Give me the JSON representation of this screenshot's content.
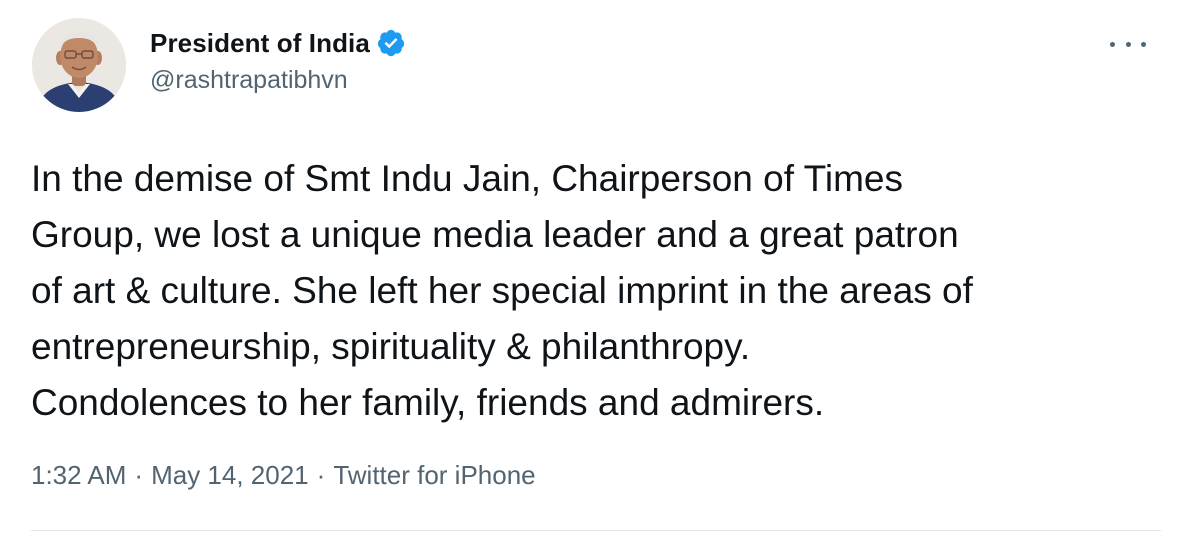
{
  "author": {
    "display_name": "President of India",
    "handle": "@rashtrapatibhvn",
    "verified": true,
    "avatar_icon": "profile-photo"
  },
  "tweet": {
    "text": "In the demise of Smt Indu Jain, Chairperson of Times\nGroup, we lost a unique media leader and a great patron\nof art & culture. She left her special imprint in the areas of\nentrepreneurship, spirituality & philanthropy.\nCondolences to her family, friends and admirers."
  },
  "meta": {
    "time": "1:32 AM",
    "separator": "·",
    "date": "May 14, 2021",
    "source": "Twitter for iPhone"
  },
  "colors": {
    "verified_badge": "#1d9bf0",
    "text": "#0f1419",
    "secondary_text": "#536471",
    "divider": "#dfe4e8"
  },
  "icons": {
    "more": "more-options-icon",
    "verified": "verified-badge-icon"
  }
}
